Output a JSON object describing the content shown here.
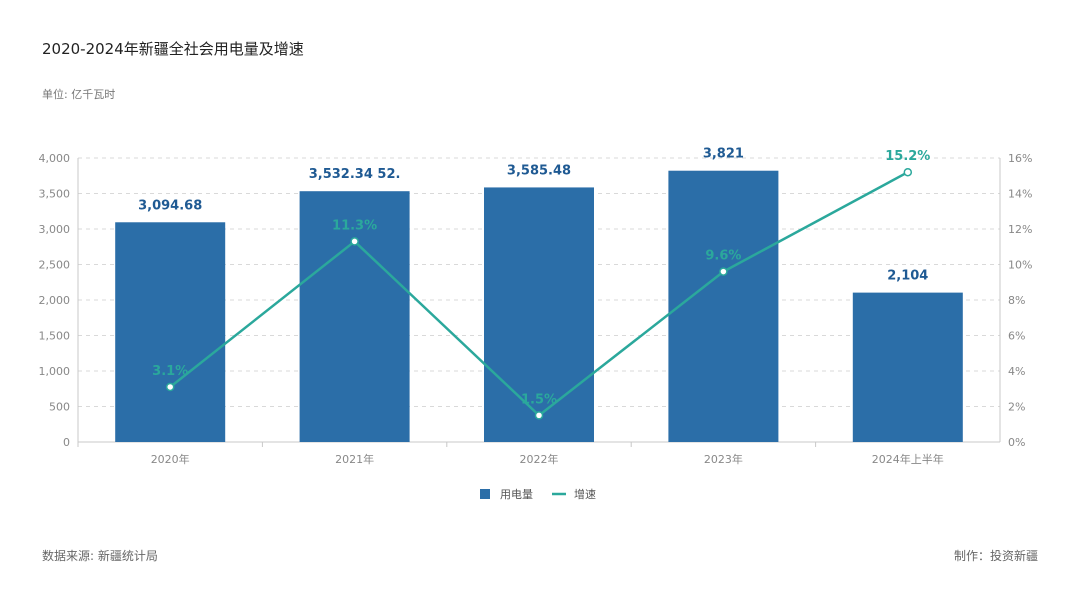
{
  "header": {
    "title": "2020-2024年新疆全社会用电量及增速",
    "unit": "单位: 亿千瓦时"
  },
  "footer": {
    "source": "数据来源: 新疆统计局",
    "maker": "制作：投资新疆"
  },
  "colors": {
    "bar": "#2b6ea8",
    "line": "#2ba89c",
    "bar_label": "#1f5a93",
    "line_label": "#2ba89c",
    "grid": "#d9d9d9"
  },
  "chart_data": {
    "type": "bar",
    "categories": [
      "2020年",
      "2021年",
      "2022年",
      "2023年",
      "2024年上半年"
    ],
    "series": [
      {
        "name": "用电量",
        "type": "bar",
        "axis": "left",
        "values": [
          3094.68,
          3532.34,
          3585.48,
          3821,
          2104
        ],
        "labels": [
          "3,094.68",
          "3,532.34 52.",
          "3,585.48",
          "3,821",
          "2,104"
        ]
      },
      {
        "name": "增速",
        "type": "line",
        "axis": "right",
        "values": [
          3.1,
          11.3,
          1.5,
          9.6,
          15.2
        ],
        "labels": [
          "3.1%",
          "11.3%",
          "1.5%",
          "9.6%",
          "15.2%"
        ]
      }
    ],
    "y_left": {
      "range": [
        0,
        4000
      ],
      "ticks": [
        0,
        500,
        1000,
        1500,
        2000,
        2500,
        3000,
        3500,
        4000
      ],
      "tick_labels": [
        "0",
        "500",
        "1,000",
        "1,500",
        "2,000",
        "2,500",
        "3,000",
        "3,500",
        "4,000"
      ]
    },
    "y_right": {
      "range": [
        0,
        16
      ],
      "ticks": [
        0,
        2,
        4,
        6,
        8,
        10,
        12,
        14,
        16
      ],
      "tick_labels": [
        "0%",
        "2%",
        "4%",
        "6%",
        "8%",
        "10%",
        "12%",
        "14%",
        "16%"
      ]
    },
    "grid": true,
    "legend_position": "bottom"
  }
}
